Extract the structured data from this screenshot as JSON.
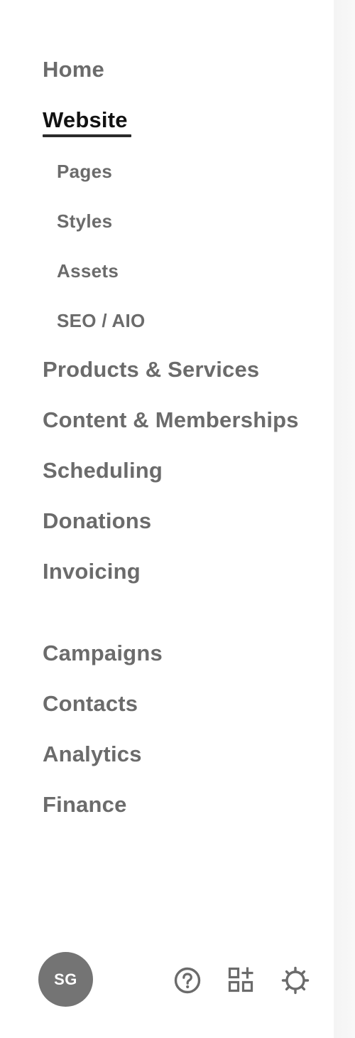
{
  "nav": {
    "primary_top": [
      {
        "label": "Home",
        "name": "sidebar-item-home",
        "active": false
      },
      {
        "label": "Website",
        "name": "sidebar-item-website",
        "active": true
      }
    ],
    "website_sub": [
      {
        "label": "Pages",
        "name": "sidebar-subitem-pages"
      },
      {
        "label": "Styles",
        "name": "sidebar-subitem-styles"
      },
      {
        "label": "Assets",
        "name": "sidebar-subitem-assets"
      },
      {
        "label": "SEO / AIO",
        "name": "sidebar-subitem-seo-aio"
      }
    ],
    "primary_mid": [
      {
        "label": "Products & Services",
        "name": "sidebar-item-products-services"
      },
      {
        "label": "Content & Memberships",
        "name": "sidebar-item-content-memberships"
      },
      {
        "label": "Scheduling",
        "name": "sidebar-item-scheduling"
      },
      {
        "label": "Donations",
        "name": "sidebar-item-donations"
      },
      {
        "label": "Invoicing",
        "name": "sidebar-item-invoicing"
      }
    ],
    "primary_bottom": [
      {
        "label": "Campaigns",
        "name": "sidebar-item-campaigns"
      },
      {
        "label": "Contacts",
        "name": "sidebar-item-contacts"
      },
      {
        "label": "Analytics",
        "name": "sidebar-item-analytics"
      },
      {
        "label": "Finance",
        "name": "sidebar-item-finance"
      }
    ]
  },
  "footer": {
    "avatar_initials": "SG",
    "icons": [
      {
        "name": "help-icon"
      },
      {
        "name": "add-extension-icon"
      },
      {
        "name": "settings-gear-icon"
      }
    ]
  },
  "colors": {
    "nav_text": "#6b6b6b",
    "active_text": "#121212",
    "avatar_bg": "#747474"
  }
}
